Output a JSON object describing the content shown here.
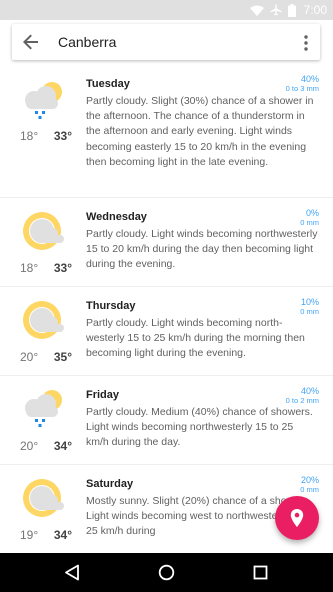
{
  "status_bar": {
    "time": "7:00"
  },
  "search": {
    "query": "Canberra"
  },
  "colors": {
    "accent": "#e91e63",
    "rain_text": "#42a5f5",
    "sun": "#fdd663",
    "cloud": "#e0e0e0",
    "drops": "#1e88e5"
  },
  "days": [
    {
      "name": "Tuesday",
      "icon": "partly-cloudy-rain-icon",
      "min": "18°",
      "max": "33°",
      "chance": "40%",
      "amount": "0 to 3 mm",
      "description": "Partly cloudy. Slight (30%) chance of a shower in the afternoon. The chance of a thunderstorm in the afternoon and early evening. Light winds becoming easterly 15 to 20 km/h in the evening then becoming light in the late evening."
    },
    {
      "name": "Wednesday",
      "icon": "partly-cloudy-icon",
      "min": "18°",
      "max": "33°",
      "chance": "0%",
      "amount": "0 mm",
      "description": "Partly cloudy. Light winds becoming northwesterly 15 to 20 km/h during the day then becoming light during the evening."
    },
    {
      "name": "Thursday",
      "icon": "partly-cloudy-icon",
      "min": "20°",
      "max": "35°",
      "chance": "10%",
      "amount": "0 mm",
      "description": "Partly cloudy. Light winds becoming north-westerly 15 to 25 km/h during the morning then becoming light during the evening."
    },
    {
      "name": "Friday",
      "icon": "partly-cloudy-rain-icon",
      "min": "20°",
      "max": "34°",
      "chance": "40%",
      "amount": "0 to 2 mm",
      "description": "Partly cloudy. Medium (40%) chance of showers. Light winds becoming northwesterly 15 to 25 km/h during the day."
    },
    {
      "name": "Saturday",
      "icon": "partly-cloudy-icon",
      "min": "19°",
      "max": "34°",
      "chance": "20%",
      "amount": "0 mm",
      "description": "Mostly sunny. Slight (20%) chance of a shower. Light winds becoming west to northwesterly 15 to 25 km/h during"
    }
  ]
}
